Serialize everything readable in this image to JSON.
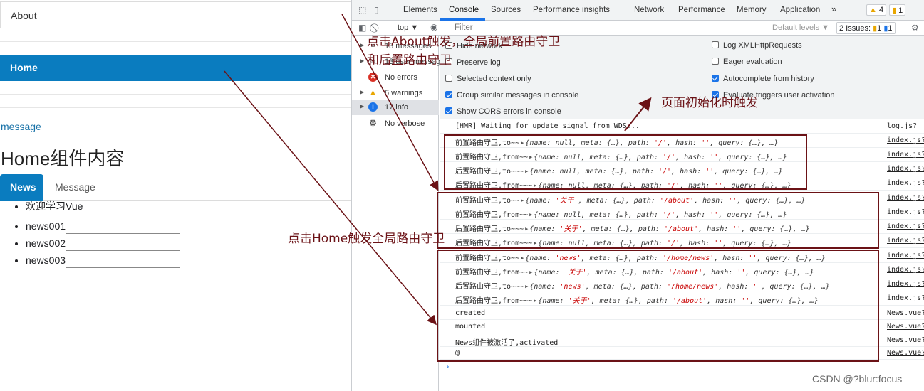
{
  "app": {
    "nav": {
      "about": "About",
      "home": "Home"
    },
    "message_link": "message",
    "home_title": "Home组件内容",
    "tabs": {
      "news": "News",
      "message": "Message"
    },
    "list": [
      {
        "label": "欢迎学习Vue"
      },
      {
        "label": "news001",
        "input_value": ""
      },
      {
        "label": "news002",
        "input_value": ""
      },
      {
        "label": "news003",
        "input_value": ""
      }
    ]
  },
  "devtools": {
    "tabs": [
      "Elements",
      "Console",
      "Sources",
      "Performance insights",
      "Network",
      "Performance",
      "Memory",
      "Application"
    ],
    "active_tab": "Console",
    "more": "»",
    "warn_badge": "4",
    "issue_badge": "1",
    "toolbar": {
      "context": "top ▼",
      "filter_placeholder": "Filter",
      "levels": "Default levels ▼",
      "issues": "2 Issues:",
      "issues_warn": "1",
      "issues_info": "1"
    },
    "sidebar": [
      {
        "label": "13 messages",
        "icon": "list-icon"
      },
      {
        "label": "13 user messages",
        "icon": "user-icon"
      },
      {
        "label": "No errors",
        "icon": "error-icon"
      },
      {
        "label": "6 warnings",
        "icon": "warning-icon"
      },
      {
        "label": "17 info",
        "icon": "info-icon",
        "selected": true
      },
      {
        "label": "No verbose",
        "icon": "gear-icon"
      }
    ],
    "settings": {
      "left": [
        {
          "label": "Hide network",
          "checked": false
        },
        {
          "label": "Preserve log",
          "checked": false
        },
        {
          "label": "Selected context only",
          "checked": false
        },
        {
          "label": "Group similar messages in console",
          "checked": true
        },
        {
          "label": "Show CORS errors in console",
          "checked": true
        }
      ],
      "right": [
        {
          "label": "Log XMLHttpRequests",
          "checked": false
        },
        {
          "label": "Eager evaluation",
          "checked": false
        },
        {
          "label": "Autocomplete from history",
          "checked": true
        },
        {
          "label": "Evaluate triggers user activation",
          "checked": true
        }
      ]
    },
    "console": {
      "hmr": "[HMR] Waiting for update signal from WDS...",
      "hmr_src": "log.js?",
      "logs": [
        {
          "prefix": "前置路由守卫,to~~",
          "name": "null",
          "path": "'/'",
          "src": "index.js?"
        },
        {
          "prefix": "前置路由守卫,from~~",
          "name": "null",
          "path": "'/'",
          "src": "index.js?"
        },
        {
          "prefix": "后置路由守卫,to~~~",
          "name": "null",
          "path": "'/'",
          "src": "index.js?"
        },
        {
          "prefix": "后置路由守卫,from~~~",
          "name": "null",
          "path": "'/'",
          "src": "index.js?"
        },
        {
          "prefix": "前置路由守卫,to~~",
          "name": "'关于'",
          "path": "'/about'",
          "src": "index.js?"
        },
        {
          "prefix": "前置路由守卫,from~~",
          "name": "null",
          "path": "'/'",
          "src": "index.js?"
        },
        {
          "prefix": "后置路由守卫,to~~~",
          "name": "'关于'",
          "path": "'/about'",
          "src": "index.js?"
        },
        {
          "prefix": "后置路由守卫,from~~~",
          "name": "null",
          "path": "'/'",
          "src": "index.js?"
        },
        {
          "prefix": "前置路由守卫,to~~",
          "name": "'news'",
          "path": "'/home/news'",
          "src": "index.js?"
        },
        {
          "prefix": "前置路由守卫,from~~",
          "name": "'关于'",
          "path": "'/about'",
          "src": "index.js?"
        },
        {
          "prefix": "后置路由守卫,to~~~",
          "name": "'news'",
          "path": "'/home/news'",
          "src": "index.js?"
        },
        {
          "prefix": "后置路由守卫,from~~~",
          "name": "'关于'",
          "path": "'/about'",
          "src": "index.js?"
        }
      ],
      "plain": [
        {
          "text": "created",
          "src": "News.vue?"
        },
        {
          "text": "mounted",
          "src": "News.vue?"
        },
        {
          "text": "News组件被激活了,activated",
          "src": "News.vue?"
        },
        {
          "text": "@",
          "src": "News.vue?"
        }
      ],
      "prompt": "›"
    }
  },
  "annotations": {
    "about_note_line1": "点击About触发，全局前置路由守卫",
    "about_note_line2": "和后置路由守卫",
    "init_note": "页面初始化时触发",
    "home_note": "点击Home触发全局路由守卫",
    "color": "#6b1216"
  },
  "watermark": "CSDN @?blur:focus"
}
